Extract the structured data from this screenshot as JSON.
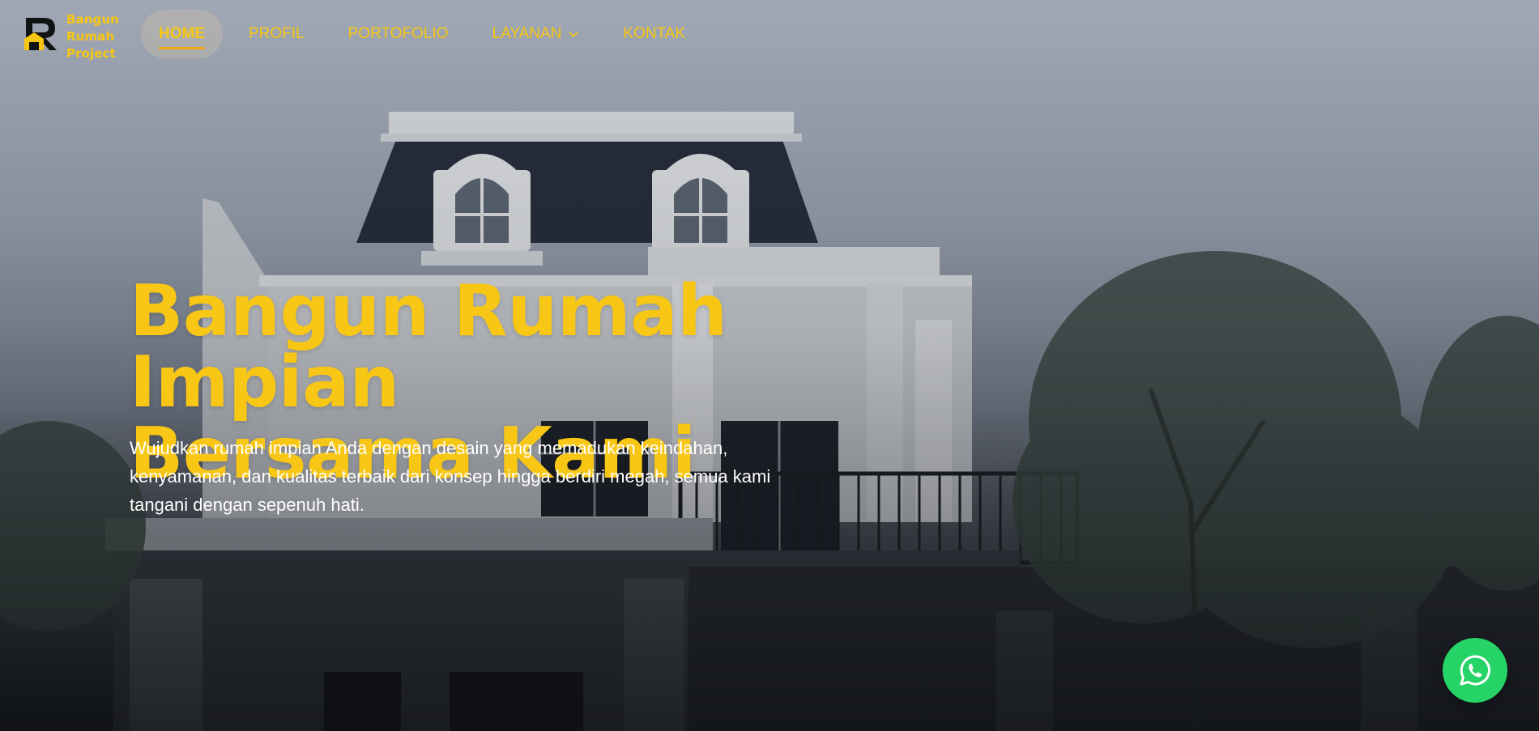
{
  "brand": {
    "name_lines": [
      "Bangun",
      "Rumah",
      "Project"
    ],
    "logo_icon": "br-logo-icon"
  },
  "nav": {
    "items": [
      {
        "label": "HOME",
        "active": true
      },
      {
        "label": "PROFIL",
        "active": false
      },
      {
        "label": "PORTOFOLIO",
        "active": false
      },
      {
        "label": "LAYANAN",
        "active": false,
        "has_dropdown": true,
        "icon": "chevron-down-icon"
      },
      {
        "label": "KONTAK",
        "active": false
      }
    ]
  },
  "hero": {
    "title_lines": [
      "Bangun Rumah Impian",
      "Bersama Kami"
    ],
    "description": "Wujudkan rumah impian Anda dengan desain yang memadukan keindahan, kenyamanan, dan kualitas terbaik dari konsep hingga berdiri megah, semua kami tangani dengan sepenuh hati.",
    "background": "house-photo"
  },
  "floating": {
    "whatsapp_icon": "whatsapp-icon"
  },
  "colors": {
    "accent": "#f7c613",
    "active_underline": "#f7a613",
    "whatsapp": "#25d366"
  }
}
